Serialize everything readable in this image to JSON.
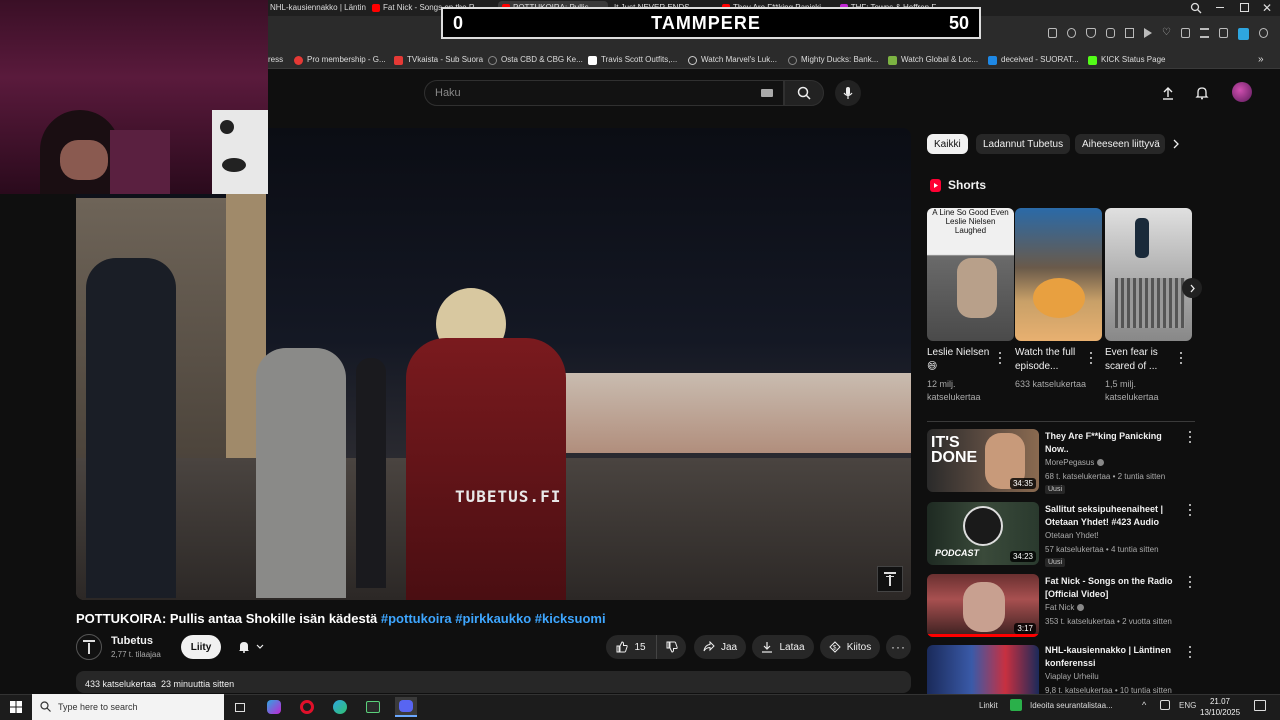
{
  "browser": {
    "tabs": [
      {
        "label": "NHL-kausiennakko | Läntin",
        "color": "#ff0000"
      },
      {
        "label": "Fat Nick - Songs on the R",
        "color": "#ff0000"
      },
      {
        "label": "POTTUKOIRA: Pullis",
        "color": "#ff0000"
      },
      {
        "label": "It Just NEVER ENDS...",
        "color": "#ff0000"
      },
      {
        "label": "They Are F**king Panicki",
        "color": "#ff0000"
      },
      {
        "label": "THF: Towns & Heffren F...",
        "color": "#c026d3"
      }
    ],
    "bookmarks": [
      {
        "label": "ress",
        "color": "#888888"
      },
      {
        "label": "Pro membership - G...",
        "color": "#e53935"
      },
      {
        "label": "TVkaista - Sub Suora",
        "color": "#e53935"
      },
      {
        "label": "Osta CBD & CBG Ke...",
        "color": "#888888"
      },
      {
        "label": "Travis Scott Outfits,...",
        "color": "#ffffff"
      },
      {
        "label": "Watch Marvel's Luk...",
        "color": "#cccccc"
      },
      {
        "label": "Mighty Ducks: Bank...",
        "color": "#888888"
      },
      {
        "label": "Watch Global & Loc...",
        "color": "#7cb342"
      },
      {
        "label": "deceived - SUORAT...",
        "color": "#1e88e5"
      },
      {
        "label": "KICK Status Page",
        "color": "#53fc18"
      }
    ]
  },
  "score": {
    "left": "0",
    "team": "TAMMPERE",
    "right": "50"
  },
  "search": {
    "placeholder": "Haku"
  },
  "video": {
    "watermark": "TUBETUS.FI",
    "title": "POTTUKOIRA: Pullis antaa Shokille isän kädestä",
    "tags": "#pottukoira #pirkkaukko #kicksuomi",
    "channel": "Tubetus",
    "subscribers": "2,77 t. tilaajaa",
    "join_label": "Liity",
    "likes": "15",
    "share_label": "Jaa",
    "download_label": "Lataa",
    "thanks_label": "Kiitos",
    "description": "433 katselukertaa  23 minuuttia sitten"
  },
  "chips": [
    "Kaikki",
    "Ladannut Tubetus",
    "Aiheeseen liittyvä"
  ],
  "shorts": {
    "title": "Shorts",
    "items": [
      {
        "overlay": "A Line So Good Even Leslie Nielsen Laughed",
        "title": "Leslie Nielsen 😄",
        "views": "12 milj. katselukertaa"
      },
      {
        "overlay": "",
        "title": "Watch the full episode...",
        "views": "633 katselukertaa"
      },
      {
        "overlay": "",
        "title": "Even fear is scared of ...",
        "views": "1,5 milj. katselukertaa"
      }
    ]
  },
  "recommendations": [
    {
      "title": "They Are F**king Panicking Now..",
      "channel": "MorePegasus",
      "meta": "68 t. katselukertaa • 2 tuntia sitten",
      "duration": "34:35",
      "badge": "Uusi",
      "thumb_text": "IT'S DONE"
    },
    {
      "title": "Sallitut seksipuheenaiheet | Otetaan Yhdet! #423 Audio",
      "channel": "Otetaan Yhdet!",
      "meta": "57 katselukertaa • 4 tuntia sitten",
      "duration": "34:23",
      "badge": "Uusi",
      "thumb_text": "PODCAST"
    },
    {
      "title": "Fat Nick - Songs on the Radio [Official Video]",
      "channel": "Fat Nick",
      "meta": "353 t. katselukertaa • 2 vuotta sitten",
      "duration": "3:17",
      "badge": "",
      "thumb_text": ""
    },
    {
      "title": "NHL-kausiennakko | Läntinen konferenssi",
      "channel": "Viaplay Urheilu",
      "meta": "9,8 t. katselukertaa • 10 tuntia sitten",
      "duration": "",
      "badge": "",
      "thumb_text": ""
    }
  ],
  "taskbar": {
    "search_placeholder": "Type here to search",
    "links_label": "Linkit",
    "notification": "Ideoita seurantalistaa...",
    "language": "ENG",
    "time": "21.07",
    "date": "13/10/2025"
  }
}
